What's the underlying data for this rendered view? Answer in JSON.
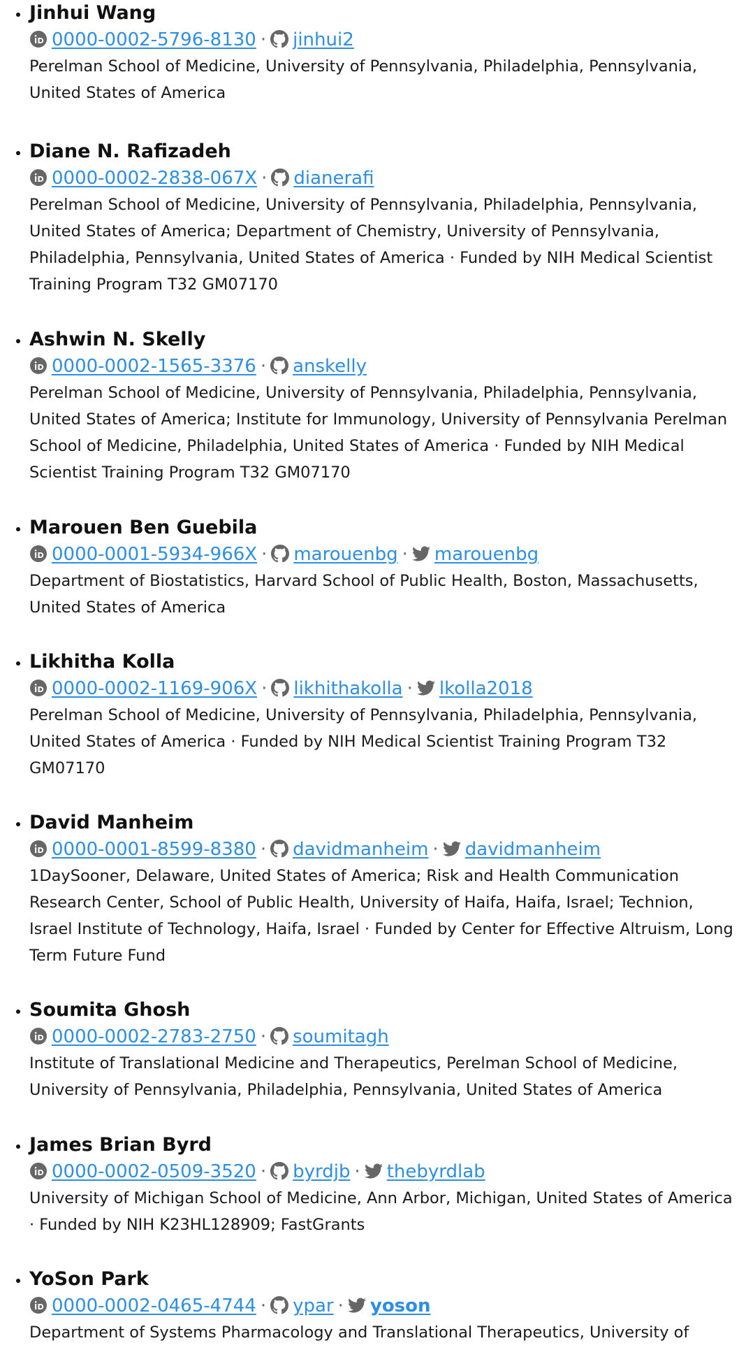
{
  "authors": [
    {
      "name": "Jinhui Wang",
      "orcid": "0000-0002-5796-8130",
      "github": "jinhui2",
      "twitter": null,
      "affiliation": "Perelman School of Medicine, University of Pennsylvania, Philadelphia, Pennsylvania, United States of America"
    },
    {
      "name": "Diane N. Rafizadeh",
      "orcid": "0000-0002-2838-067X",
      "github": "dianerafi",
      "twitter": null,
      "affiliation": "Perelman School of Medicine, University of Pennsylvania, Philadelphia, Pennsylvania, United States of America; Department of Chemistry, University of Pennsylvania, Philadelphia, Pennsylvania, United States of America · Funded by NIH Medical Scientist Training Program T32 GM07170"
    },
    {
      "name": "Ashwin N. Skelly",
      "orcid": "0000-0002-1565-3376",
      "github": "anskelly",
      "twitter": null,
      "affiliation": "Perelman School of Medicine, University of Pennsylvania, Philadelphia, Pennsylvania, United States of America; Institute for Immunology, University of Pennsylvania Perelman School of Medicine, Philadelphia, United States of America · Funded by NIH Medical Scientist Training Program T32 GM07170"
    },
    {
      "name": "Marouen Ben Guebila",
      "orcid": "0000-0001-5934-966X",
      "github": "marouenbg",
      "twitter": "marouenbg",
      "affiliation": "Department of Biostatistics, Harvard School of Public Health, Boston, Massachusetts, United States of America"
    },
    {
      "name": "Likhitha Kolla",
      "orcid": "0000-0002-1169-906X",
      "github": "likhithakolla",
      "twitter": "lkolla2018",
      "affiliation": "Perelman School of Medicine, University of Pennsylvania, Philadelphia, Pennsylvania, United States of America · Funded by NIH Medical Scientist Training Program T32 GM07170"
    },
    {
      "name": "David Manheim",
      "orcid": "0000-0001-8599-8380",
      "github": "davidmanheim",
      "twitter": "davidmanheim",
      "affiliation": "1DaySooner, Delaware, United States of America; Risk and Health Communication Research Center, School of Public Health, University of Haifa, Haifa, Israel; Technion, Israel Institute of Technology, Haifa, Israel · Funded by Center for Effective Altruism, Long Term Future Fund"
    },
    {
      "name": "Soumita Ghosh",
      "orcid": "0000-0002-2783-2750",
      "github": "soumitagh",
      "twitter": null,
      "affiliation": "Institute of Translational Medicine and Therapeutics, Perelman School of Medicine, University of Pennsylvania, Philadelphia, Pennsylvania, United States of America"
    },
    {
      "name": "James Brian Byrd",
      "orcid": "0000-0002-0509-3520",
      "github": "byrdjb",
      "twitter": "thebyrdlab",
      "affiliation": "University of Michigan School of Medicine, Ann Arbor, Michigan, United States of America · Funded by NIH K23HL128909; FastGrants"
    },
    {
      "name": "YoSon Park",
      "orcid": "0000-0002-0465-4744",
      "github": "ypar",
      "twitter": "yoson",
      "affiliation": "Department of Systems Pharmacology and Translational Therapeutics, University of"
    }
  ],
  "separator": "·",
  "icons": {
    "orcid": "orcid-icon",
    "github": "github-icon",
    "twitter": "twitter-icon"
  },
  "colors": {
    "link": "#2d8ee4",
    "icon": "#666666",
    "text": "#111111"
  }
}
